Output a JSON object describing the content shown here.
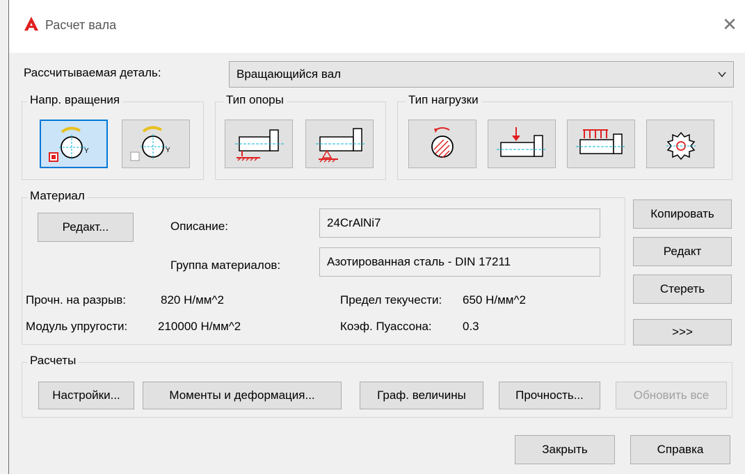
{
  "window": {
    "title": "Расчет вала",
    "close_glyph": "✕"
  },
  "part": {
    "label": "Рассчитываемая деталь:",
    "value": "Вращающийся вал"
  },
  "rotation": {
    "title": "Напр. вращения"
  },
  "support": {
    "title": "Тип опоры"
  },
  "load": {
    "title": "Тип нагрузки"
  },
  "material": {
    "title": "Материал",
    "edit_button": "Редакт...",
    "description_label": "Описание:",
    "description_value": "24CrAlNi7",
    "group_label": "Группа материалов:",
    "group_value": "Азотированная сталь - DIN 17211",
    "tensile_label": "Прочн. на разрыв:",
    "tensile_value": "820 Н/мм^2",
    "yield_label": "Предел текучести:",
    "yield_value": "650 Н/мм^2",
    "modulus_label": "Модуль упругости:",
    "modulus_value": "210000 Н/мм^2",
    "poisson_label": "Коэф. Пуассона:",
    "poisson_value": "0.3"
  },
  "side_buttons": {
    "copy": "Копировать",
    "edit": "Редакт",
    "delete": "Стереть",
    "more": ">>>"
  },
  "calculations": {
    "title": "Расчеты",
    "settings": "Настройки...",
    "moments": "Моменты и деформация...",
    "graphs": "Граф. величины",
    "strength": "Прочность...",
    "update_all": "Обновить все"
  },
  "footer": {
    "close": "Закрыть",
    "help": "Справка"
  },
  "colors": {
    "accent": "#0078d7",
    "red": "#e02020",
    "cyan": "#00b4d8"
  }
}
